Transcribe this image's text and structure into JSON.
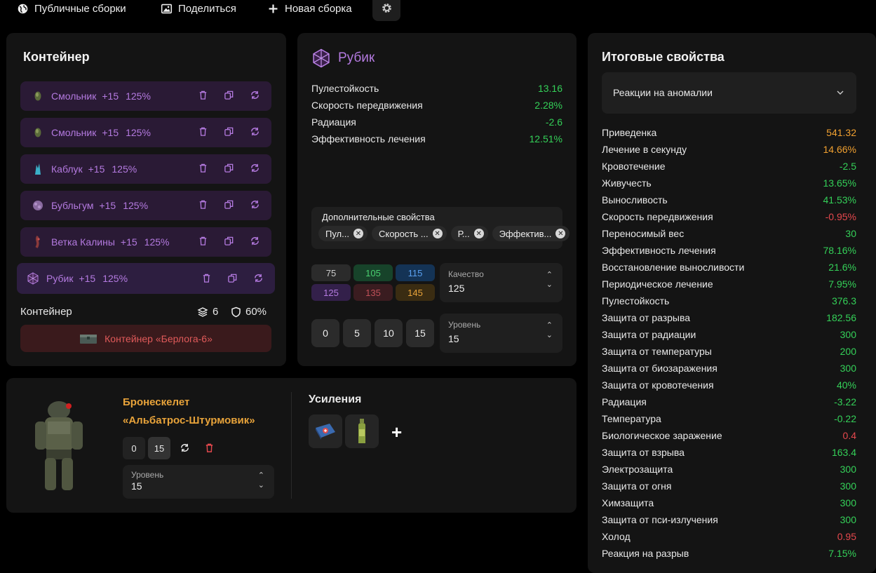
{
  "nav": {
    "public_builds": "Публичные сборки",
    "share": "Поделиться",
    "new_build": "Новая сборка"
  },
  "container_panel": {
    "title": "Контейнер",
    "items": [
      {
        "name": "Смольник",
        "plus": "+15",
        "pct": "125%",
        "icon": "smolnik-artifact-icon"
      },
      {
        "name": "Смольник",
        "plus": "+15",
        "pct": "125%",
        "icon": "smolnik-artifact-icon"
      },
      {
        "name": "Каблук",
        "plus": "+15",
        "pct": "125%",
        "icon": "kabluk-artifact-icon"
      },
      {
        "name": "Бубльгум",
        "plus": "+15",
        "pct": "125%",
        "icon": "bubblegum-artifact-icon"
      },
      {
        "name": "Ветка Калины",
        "plus": "+15",
        "pct": "125%",
        "icon": "kalina-artifact-icon"
      },
      {
        "name": "Рубик",
        "plus": "+15",
        "pct": "125%",
        "icon": "rubik-artifact-icon"
      }
    ],
    "footer_label": "Контейнер",
    "slots": "6",
    "protection": "60%",
    "container_name": "Контейнер «Берлога-6»"
  },
  "artifact_panel": {
    "title": "Рубик",
    "stats": [
      {
        "label": "Пулестойкость",
        "value": "13.16"
      },
      {
        "label": "Скорость передвижения",
        "value": "2.28%"
      },
      {
        "label": "Радиация",
        "value": "-2.6"
      },
      {
        "label": "Эффективность лечения",
        "value": "12.51%"
      }
    ],
    "extra_title": "Дополнительные свойства",
    "extra_chips": [
      "Пул...",
      "Скорость ...",
      "Р...",
      "Эффектив..."
    ],
    "quality_buttons": [
      "75",
      "105",
      "115",
      "125",
      "135",
      "145"
    ],
    "quality_label": "Качество",
    "quality_value": "125",
    "level_buttons": [
      "0",
      "5",
      "10",
      "15"
    ],
    "level_label": "Уровень",
    "level_value": "15"
  },
  "armor_panel": {
    "name_line1": "Бронескелет",
    "name_line2": "«Альбатрос-Штурмовик»",
    "level_buttons": [
      "0",
      "15"
    ],
    "level_label": "Уровень",
    "level_value": "15",
    "boosts_title": "Усиления",
    "add": "+"
  },
  "totals_panel": {
    "title": "Итоговые свойства",
    "dropdown": "Реакции на аномалии",
    "stats": [
      {
        "label": "Приведенка",
        "value": "541.32",
        "color": "o"
      },
      {
        "label": "Лечение в секунду",
        "value": "14.66%",
        "color": "o"
      },
      {
        "label": "Кровотечение",
        "value": "-2.5",
        "color": "g"
      },
      {
        "label": "Живучесть",
        "value": "13.65%",
        "color": "g"
      },
      {
        "label": "Выносливость",
        "value": "41.53%",
        "color": "g"
      },
      {
        "label": "Скорость передвижения",
        "value": "-0.95%",
        "color": "r"
      },
      {
        "label": "Переносимый вес",
        "value": "30",
        "color": "g"
      },
      {
        "label": "Эффективность лечения",
        "value": "78.16%",
        "color": "g"
      },
      {
        "label": "Восстановление выносливости",
        "value": "21.6%",
        "color": "g"
      },
      {
        "label": "Периодическое лечение",
        "value": "7.95%",
        "color": "g"
      },
      {
        "label": "Пулестойкость",
        "value": "376.3",
        "color": "g"
      },
      {
        "label": "Защита от разрыва",
        "value": "182.56",
        "color": "g"
      },
      {
        "label": "Защита от радиации",
        "value": "300",
        "color": "g"
      },
      {
        "label": "Защита от температуры",
        "value": "200",
        "color": "g"
      },
      {
        "label": "Защита от биозаражения",
        "value": "300",
        "color": "g"
      },
      {
        "label": "Защита от кровотечения",
        "value": "40%",
        "color": "g"
      },
      {
        "label": "Радиация",
        "value": "-3.22",
        "color": "g"
      },
      {
        "label": "Температура",
        "value": "-0.22",
        "color": "g"
      },
      {
        "label": "Биологическое заражение",
        "value": "0.4",
        "color": "r"
      },
      {
        "label": "Защита от взрыва",
        "value": "163.4",
        "color": "g"
      },
      {
        "label": "Электрозащита",
        "value": "300",
        "color": "g"
      },
      {
        "label": "Защита от огня",
        "value": "300",
        "color": "g"
      },
      {
        "label": "Химзащита",
        "value": "300",
        "color": "g"
      },
      {
        "label": "Защита от пси-излучения",
        "value": "300",
        "color": "g"
      },
      {
        "label": "Холод",
        "value": "0.95",
        "color": "r"
      },
      {
        "label": "Реакция на разрыв",
        "value": "7.15%",
        "color": "g"
      }
    ]
  },
  "colors": {
    "accent_purple": "#b47ae0",
    "green": "#34d058",
    "orange": "#f0a030",
    "red": "#e5484d",
    "gold": "#e8a33a"
  }
}
